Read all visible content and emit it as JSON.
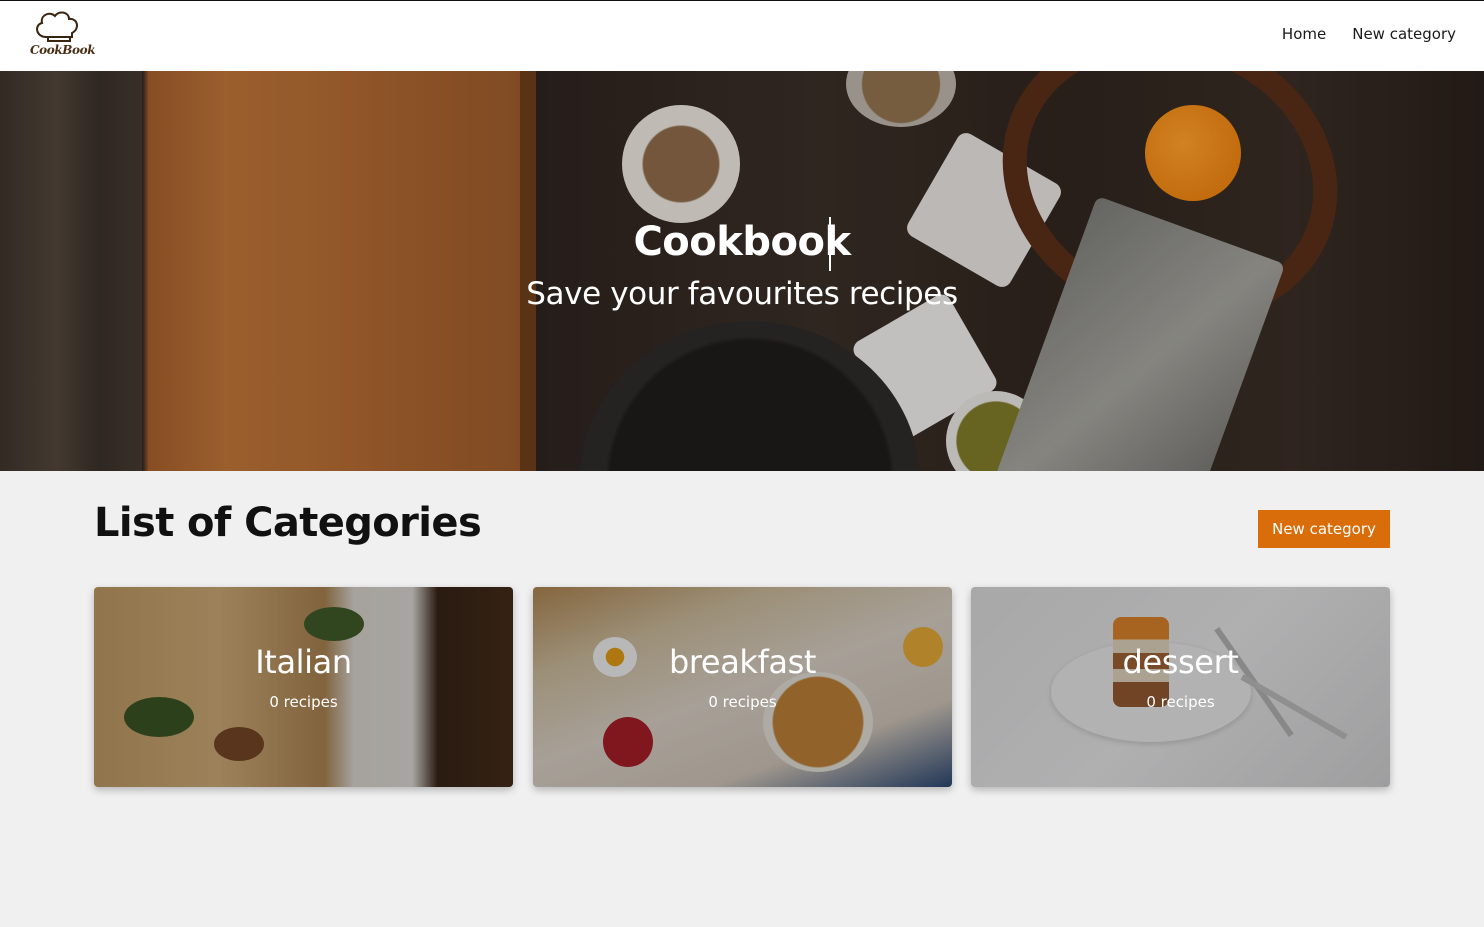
{
  "navbar": {
    "logo_text": "CookBook",
    "links": [
      "Home",
      "New category"
    ]
  },
  "hero": {
    "title": "Cookbook",
    "subtitle": "Save your favourites recipes"
  },
  "categories_section": {
    "heading": "List of Categories",
    "new_button": "New category",
    "cards": [
      {
        "name": "Italian",
        "count": "0 recipes"
      },
      {
        "name": "breakfast",
        "count": "0 recipes"
      },
      {
        "name": "dessert",
        "count": "0 recipes"
      }
    ]
  },
  "colors": {
    "accent": "#d86d0a",
    "page_bg": "#f0f0f0"
  },
  "icons": [
    "chef-hat-logo-icon"
  ]
}
